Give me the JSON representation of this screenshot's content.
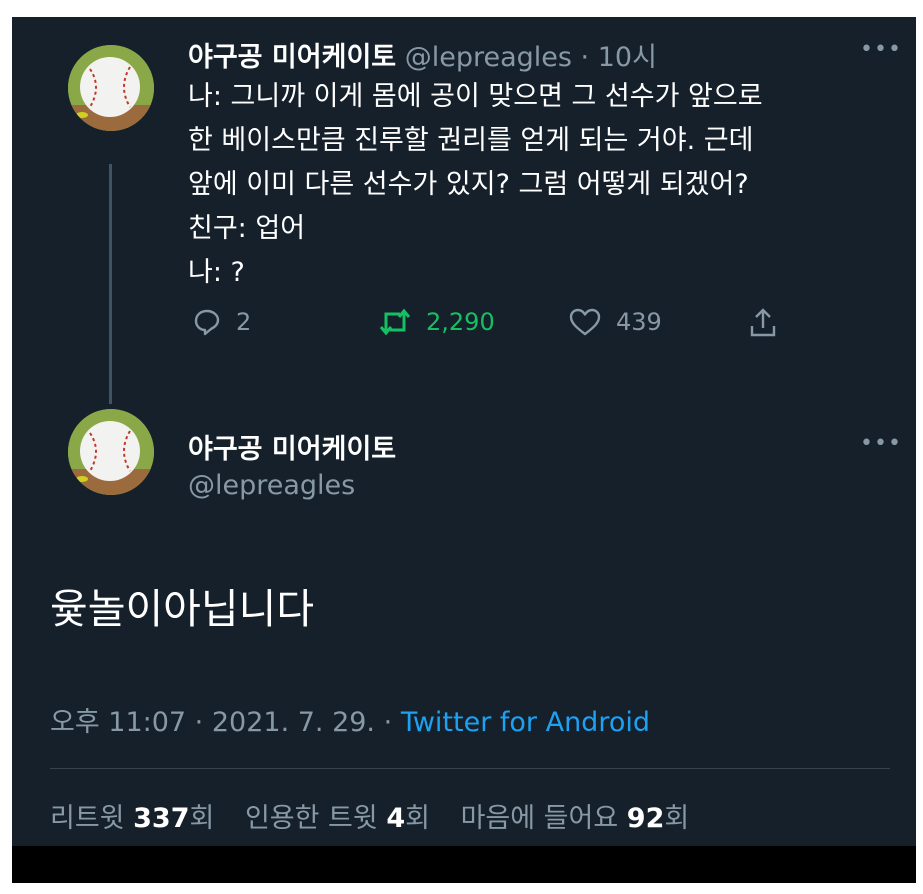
{
  "first_tweet": {
    "display_name": "야구공 미어케이토",
    "handle": "@lepreagles",
    "separator": "·",
    "time": "10시",
    "more": "•••",
    "lines": [
      "나: 그니까 이게 몸에 공이 맞으면 그 선수가 앞으로",
      "한 베이스만큼 진루할 권리를 얻게 되는 거야. 근데",
      "앞에 이미 다른 선수가 있지? 그럼 어떻게 되겠어?",
      "친구: 업어",
      "나: ?"
    ],
    "replies": "2",
    "retweets": "2,290",
    "likes": "439"
  },
  "main_tweet": {
    "display_name": "야구공 미어케이토",
    "handle": "@lepreagles",
    "more": "•••",
    "text": "윷놀이아닙니다",
    "time": "오후 11:07",
    "separator": "·",
    "date": "2021. 7. 29.",
    "separator2": "·",
    "source": "Twitter for Android",
    "stats": {
      "retweet_label": "리트윗",
      "retweet_count": "337",
      "retweet_unit": "회",
      "quote_label": "인용한 트윗",
      "quote_count": "4",
      "quote_unit": "회",
      "like_label": "마음에 들어요",
      "like_count": "92",
      "like_unit": "회"
    }
  },
  "colors": {
    "background": "#15202b",
    "text": "#ffffff",
    "muted": "#8899a6",
    "retweet_active": "#17bf63",
    "link": "#1da1f2"
  },
  "icons": [
    "reply-icon",
    "retweet-icon",
    "like-icon",
    "share-icon",
    "more-icon"
  ]
}
